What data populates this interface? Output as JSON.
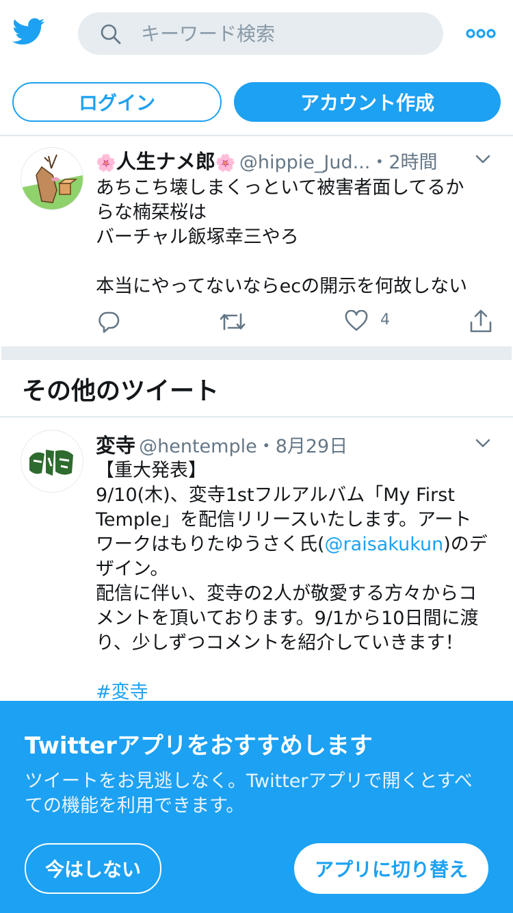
{
  "header": {
    "logo_icon": "twitter-bird-icon",
    "search_placeholder": "キーワード検索",
    "more_icon": "more-dots-icon",
    "login_label": "ログイン",
    "signup_label": "アカウント作成"
  },
  "tweet1": {
    "name_prefix_emoji": "🌸",
    "name": "人生ナメ郎",
    "name_suffix_emoji": "🌸",
    "handle": "@hippie_Jud...",
    "separator": "・",
    "time": "2時間",
    "text": "あちこち壊しまくっといて被害者面してるか\nらな楠栞桜は\nバーチャル飯塚幸三やろ\n\n本当にやってないならecの開示を何故しない",
    "like_count": "4"
  },
  "section_title": "その他のツイート",
  "tweet2": {
    "name": "変寺",
    "handle": "@hentemple",
    "separator": "・",
    "time": "8月29日",
    "text_part1": "【重大発表】\n9/10(木)、変寺1stフルアルバム「My First\nTemple」を配信リリースいたします。アート\nワークはもりたゆうさく氏(",
    "mention": "@raisakukun",
    "text_part2": ")のデ\nザイン。\n配信に伴い、変寺の2人が敬愛する方々からコ\nメントを頂いております。9/1から10日間に渡\nり、少しずつコメントを紹介していきます！",
    "hashtag": "#変寺"
  },
  "banner": {
    "title": "Twitterアプリをおすすめします",
    "text": "ツイートをお見逃しなく。Twitterアプリで開くとすべての機能を利用できます。",
    "not_now_label": "今はしない",
    "switch_label": "アプリに切り替え"
  },
  "colors": {
    "accent": "#1da1f2",
    "text": "#14171a",
    "secondary": "#657786",
    "divider": "#e6ecf0"
  }
}
